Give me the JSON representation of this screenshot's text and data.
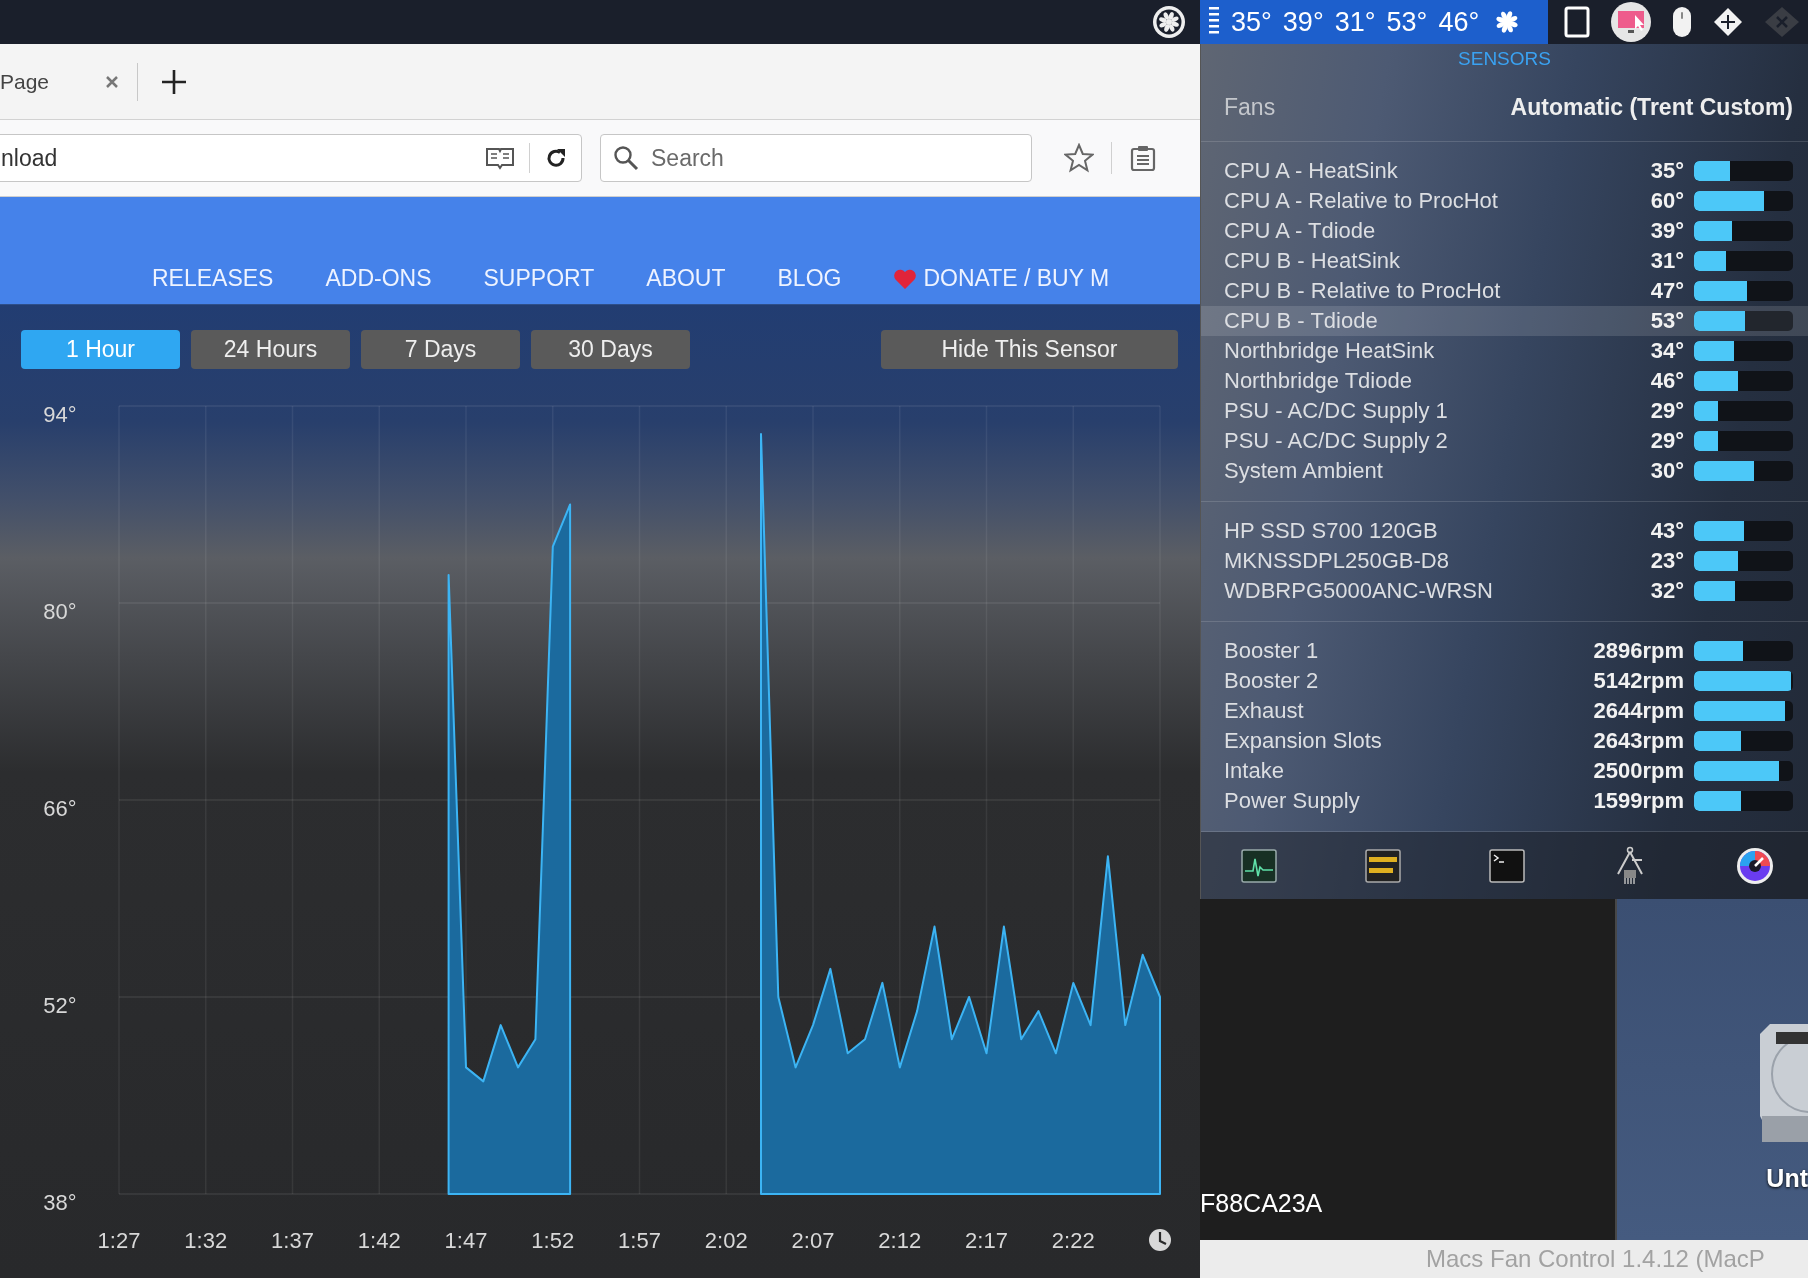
{
  "menu_bar": {
    "temperatures": [
      "35°",
      "39°",
      "31°",
      "53°",
      "46°"
    ]
  },
  "browser": {
    "tab": {
      "title": "Page"
    },
    "address_field": {
      "value": "nload"
    },
    "search_field": {
      "placeholder": "Search"
    },
    "nav": [
      "RELEASES",
      "ADD-ONS",
      "SUPPORT",
      "ABOUT",
      "BLOG",
      "DONATE / BUY M"
    ],
    "range_buttons": [
      {
        "label": "1 Hour",
        "selected": true
      },
      {
        "label": "24 Hours",
        "selected": false
      },
      {
        "label": "7 Days",
        "selected": false
      },
      {
        "label": "30 Days",
        "selected": false
      }
    ],
    "hide_button": "Hide This Sensor",
    "chart_data": {
      "type": "area",
      "categories": [
        "1:27",
        null,
        null,
        null,
        null,
        "1:32",
        null,
        null,
        null,
        null,
        "1:37",
        null,
        null,
        null,
        null,
        "1:42",
        null,
        null,
        null,
        null,
        "1:47",
        null,
        null,
        null,
        null,
        "1:52",
        null,
        null,
        null,
        null,
        "1:57",
        null,
        null,
        null,
        null,
        "2:02",
        null,
        null,
        null,
        null,
        "2:07",
        null,
        null,
        null,
        null,
        "2:12",
        null,
        null,
        null,
        null,
        "2:17",
        null,
        null,
        null,
        null,
        "2:22",
        null,
        null,
        null,
        null,
        null
      ],
      "series": [
        {
          "values": [
            null,
            null,
            null,
            null,
            null,
            null,
            null,
            null,
            null,
            null,
            null,
            null,
            null,
            null,
            null,
            null,
            null,
            null,
            null,
            82,
            47,
            46,
            50,
            47,
            49,
            84,
            87,
            null,
            null,
            null,
            null,
            null,
            null,
            null,
            null,
            null,
            null,
            92,
            52,
            47,
            50,
            54,
            48,
            49,
            53,
            47,
            51,
            57,
            49,
            52,
            48,
            57,
            49,
            51,
            48,
            53,
            50,
            62,
            50,
            55,
            52
          ]
        }
      ],
      "ylim": [
        38,
        94
      ],
      "grid": true,
      "yticks": [
        {
          "value": 94,
          "label": "94°"
        },
        {
          "value": 80,
          "label": "80°"
        },
        {
          "value": 66,
          "label": "66°"
        },
        {
          "value": 52,
          "label": "52°"
        },
        {
          "value": 38,
          "label": "38°"
        }
      ]
    }
  },
  "sensors_panel": {
    "title": "SENSORS",
    "fans_label": "Fans",
    "fans_mode": "Automatic (Trent Custom)",
    "sections": [
      {
        "rows": [
          {
            "name": "CPU A - HeatSink",
            "value": "35°",
            "level": 0.36,
            "selected": false
          },
          {
            "name": "CPU A - Relative to ProcHot",
            "value": "60°",
            "level": 0.71,
            "selected": false
          },
          {
            "name": "CPU A - Tdiode",
            "value": "39°",
            "level": 0.38,
            "selected": false
          },
          {
            "name": "CPU B - HeatSink",
            "value": "31°",
            "level": 0.32,
            "selected": false
          },
          {
            "name": "CPU B - Relative to ProcHot",
            "value": "47°",
            "level": 0.54,
            "selected": false
          },
          {
            "name": "CPU B - Tdiode",
            "value": "53°",
            "level": 0.52,
            "selected": true
          },
          {
            "name": "Northbridge HeatSink",
            "value": "34°",
            "level": 0.4,
            "selected": false
          },
          {
            "name": "Northbridge Tdiode",
            "value": "46°",
            "level": 0.44,
            "selected": false
          },
          {
            "name": "PSU - AC/DC Supply 1",
            "value": "29°",
            "level": 0.24,
            "selected": false
          },
          {
            "name": "PSU - AC/DC Supply 2",
            "value": "29°",
            "level": 0.24,
            "selected": false
          },
          {
            "name": "System Ambient",
            "value": "30°",
            "level": 0.61,
            "selected": false
          }
        ]
      },
      {
        "rows": [
          {
            "name": "HP SSD S700 120GB",
            "value": "43°",
            "level": 0.51,
            "selected": false
          },
          {
            "name": "MKNSSDPL250GB-D8",
            "value": "23°",
            "level": 0.44,
            "selected": false
          },
          {
            "name": "WDBRPG5000ANC-WRSN",
            "value": "32°",
            "level": 0.41,
            "selected": false
          }
        ]
      },
      {
        "rows": [
          {
            "name": "Booster 1",
            "value": "2896rpm",
            "level": 0.49,
            "selected": false
          },
          {
            "name": "Booster 2",
            "value": "5142rpm",
            "level": 0.98,
            "selected": false
          },
          {
            "name": "Exhaust",
            "value": "2644rpm",
            "level": 0.92,
            "selected": false
          },
          {
            "name": "Expansion Slots",
            "value": "2643rpm",
            "level": 0.47,
            "selected": false
          },
          {
            "name": "Intake",
            "value": "2500rpm",
            "level": 0.86,
            "selected": false
          },
          {
            "name": "Power Supply",
            "value": "1599rpm",
            "level": 0.47,
            "selected": false
          }
        ]
      }
    ]
  },
  "terminal": {
    "text": "F88CA23A"
  },
  "desktop": {
    "disk_label": "Unt"
  },
  "status_bar": "Macs Fan Control 1.4.12 (MacP"
}
